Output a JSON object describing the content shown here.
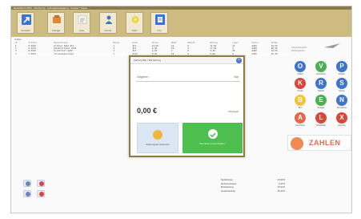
{
  "window": {
    "title": "Bestellbuch 2021 - Rechnung - Auftragsbestätigung - Fenster / Kasse"
  },
  "ribbon": {
    "buttons": [
      {
        "label": "Auswahl",
        "icon": "arrow-icon",
        "color": "#3e74c9"
      },
      {
        "label": "Vorlage",
        "icon": "storage-icon",
        "color": "#e0853a"
      },
      {
        "label": "Liste",
        "icon": "list-icon",
        "color": "#f0f0f0"
      },
      {
        "label": "Kunde",
        "icon": "customer-icon",
        "color": "#3e74c9"
      },
      {
        "label": "Notiz",
        "icon": "note-icon",
        "color": "#f2d23b"
      },
      {
        "label": "Info",
        "icon": "info-icon",
        "color": "#3e74c9"
      }
    ]
  },
  "grid": {
    "title": "Artikel",
    "headers": [
      "Nr.",
      "Artikel",
      "Bezeichnung",
      "Menge",
      "Einh.",
      "Preis",
      "MwSt",
      "Rabatt",
      "Betrag",
      "Lager",
      "Konto",
      "Summe"
    ],
    "rows": [
      [
        "1",
        "P-0012",
        "Artikel 0012 Stk",
        "1",
        "Stk",
        "12,50",
        "19",
        "0",
        "12,50",
        "12",
        "8400",
        "12,50"
      ],
      [
        "2",
        "A-2211",
        "Sonderartikel 2211",
        "2",
        "Stk",
        "8,90",
        "19",
        "0",
        "17,80",
        "5",
        "8400",
        "30,30"
      ],
      [
        "3",
        "B-8812",
        "Ersatzteil 8812",
        "1",
        "Stk",
        "4,20",
        "7",
        "0",
        "4,20",
        "20",
        "8300",
        "34,50"
      ],
      [
        "4",
        "C-0021",
        "Versandpauschale",
        "1",
        "Psch",
        "5,90",
        "19",
        "0",
        "5,90",
        "0",
        "8400",
        "40,40"
      ]
    ]
  },
  "sidebar": {
    "text_lines": [
      "Kassenübersicht",
      "Zahlungsarten"
    ],
    "actions": [
      {
        "label": "Artikel",
        "icon": "circle-o-icon",
        "color": "#3e74c9",
        "glyph": "O"
      },
      {
        "label": "Gutschein",
        "icon": "circle-v-icon",
        "color": "#4cb050",
        "glyph": "V"
      },
      {
        "label": "Parken",
        "icon": "circle-p-icon",
        "color": "#3e74c9",
        "glyph": "P"
      },
      {
        "label": "Kunde",
        "icon": "circle-k-icon",
        "color": "#d9463a",
        "glyph": "K"
      },
      {
        "label": "Rabatt",
        "icon": "circle-r-icon",
        "color": "#3e74c9",
        "glyph": "R"
      },
      {
        "label": "Storno",
        "icon": "circle-s-icon",
        "color": "#3e74c9",
        "glyph": "S"
      },
      {
        "label": "Bon",
        "icon": "circle-b-icon",
        "color": "#f2c33b",
        "glyph": "B"
      },
      {
        "label": "Einlage",
        "icon": "circle-e-icon",
        "color": "#4cb050",
        "glyph": "E"
      },
      {
        "label": "Entnahme",
        "icon": "circle-n-icon",
        "color": "#3e74c9",
        "glyph": "N"
      },
      {
        "label": "Abschluss",
        "icon": "circle-a-icon",
        "color": "#e06a4c",
        "glyph": "A"
      },
      {
        "label": "Schublade",
        "icon": "circle-l-icon",
        "color": "#d9463a",
        "glyph": "L"
      },
      {
        "label": "Löschen",
        "icon": "circle-x-icon",
        "color": "#d9463a",
        "glyph": "X"
      }
    ],
    "pay_label": "ZAHLEN"
  },
  "totals": {
    "rows": [
      {
        "label": "Nettobetrag",
        "value": "33,95 €"
      },
      {
        "label": "Mehrwertsteuer",
        "value": "6,45 €"
      },
      {
        "label": "Bruttobetrag",
        "value": "40,40 €"
      },
      {
        "label": "Gesamtbetrag",
        "value": "40,40 €"
      }
    ]
  },
  "modal": {
    "title": "Zahlung Bar / Barzahlung",
    "field_label": "Gegeben",
    "field_value": "Bar",
    "amount": "0,00 €",
    "aside": "Rückgeld",
    "btn_left": "Zahlungsart wechseln",
    "btn_right": "Barzahlung abschließen"
  }
}
